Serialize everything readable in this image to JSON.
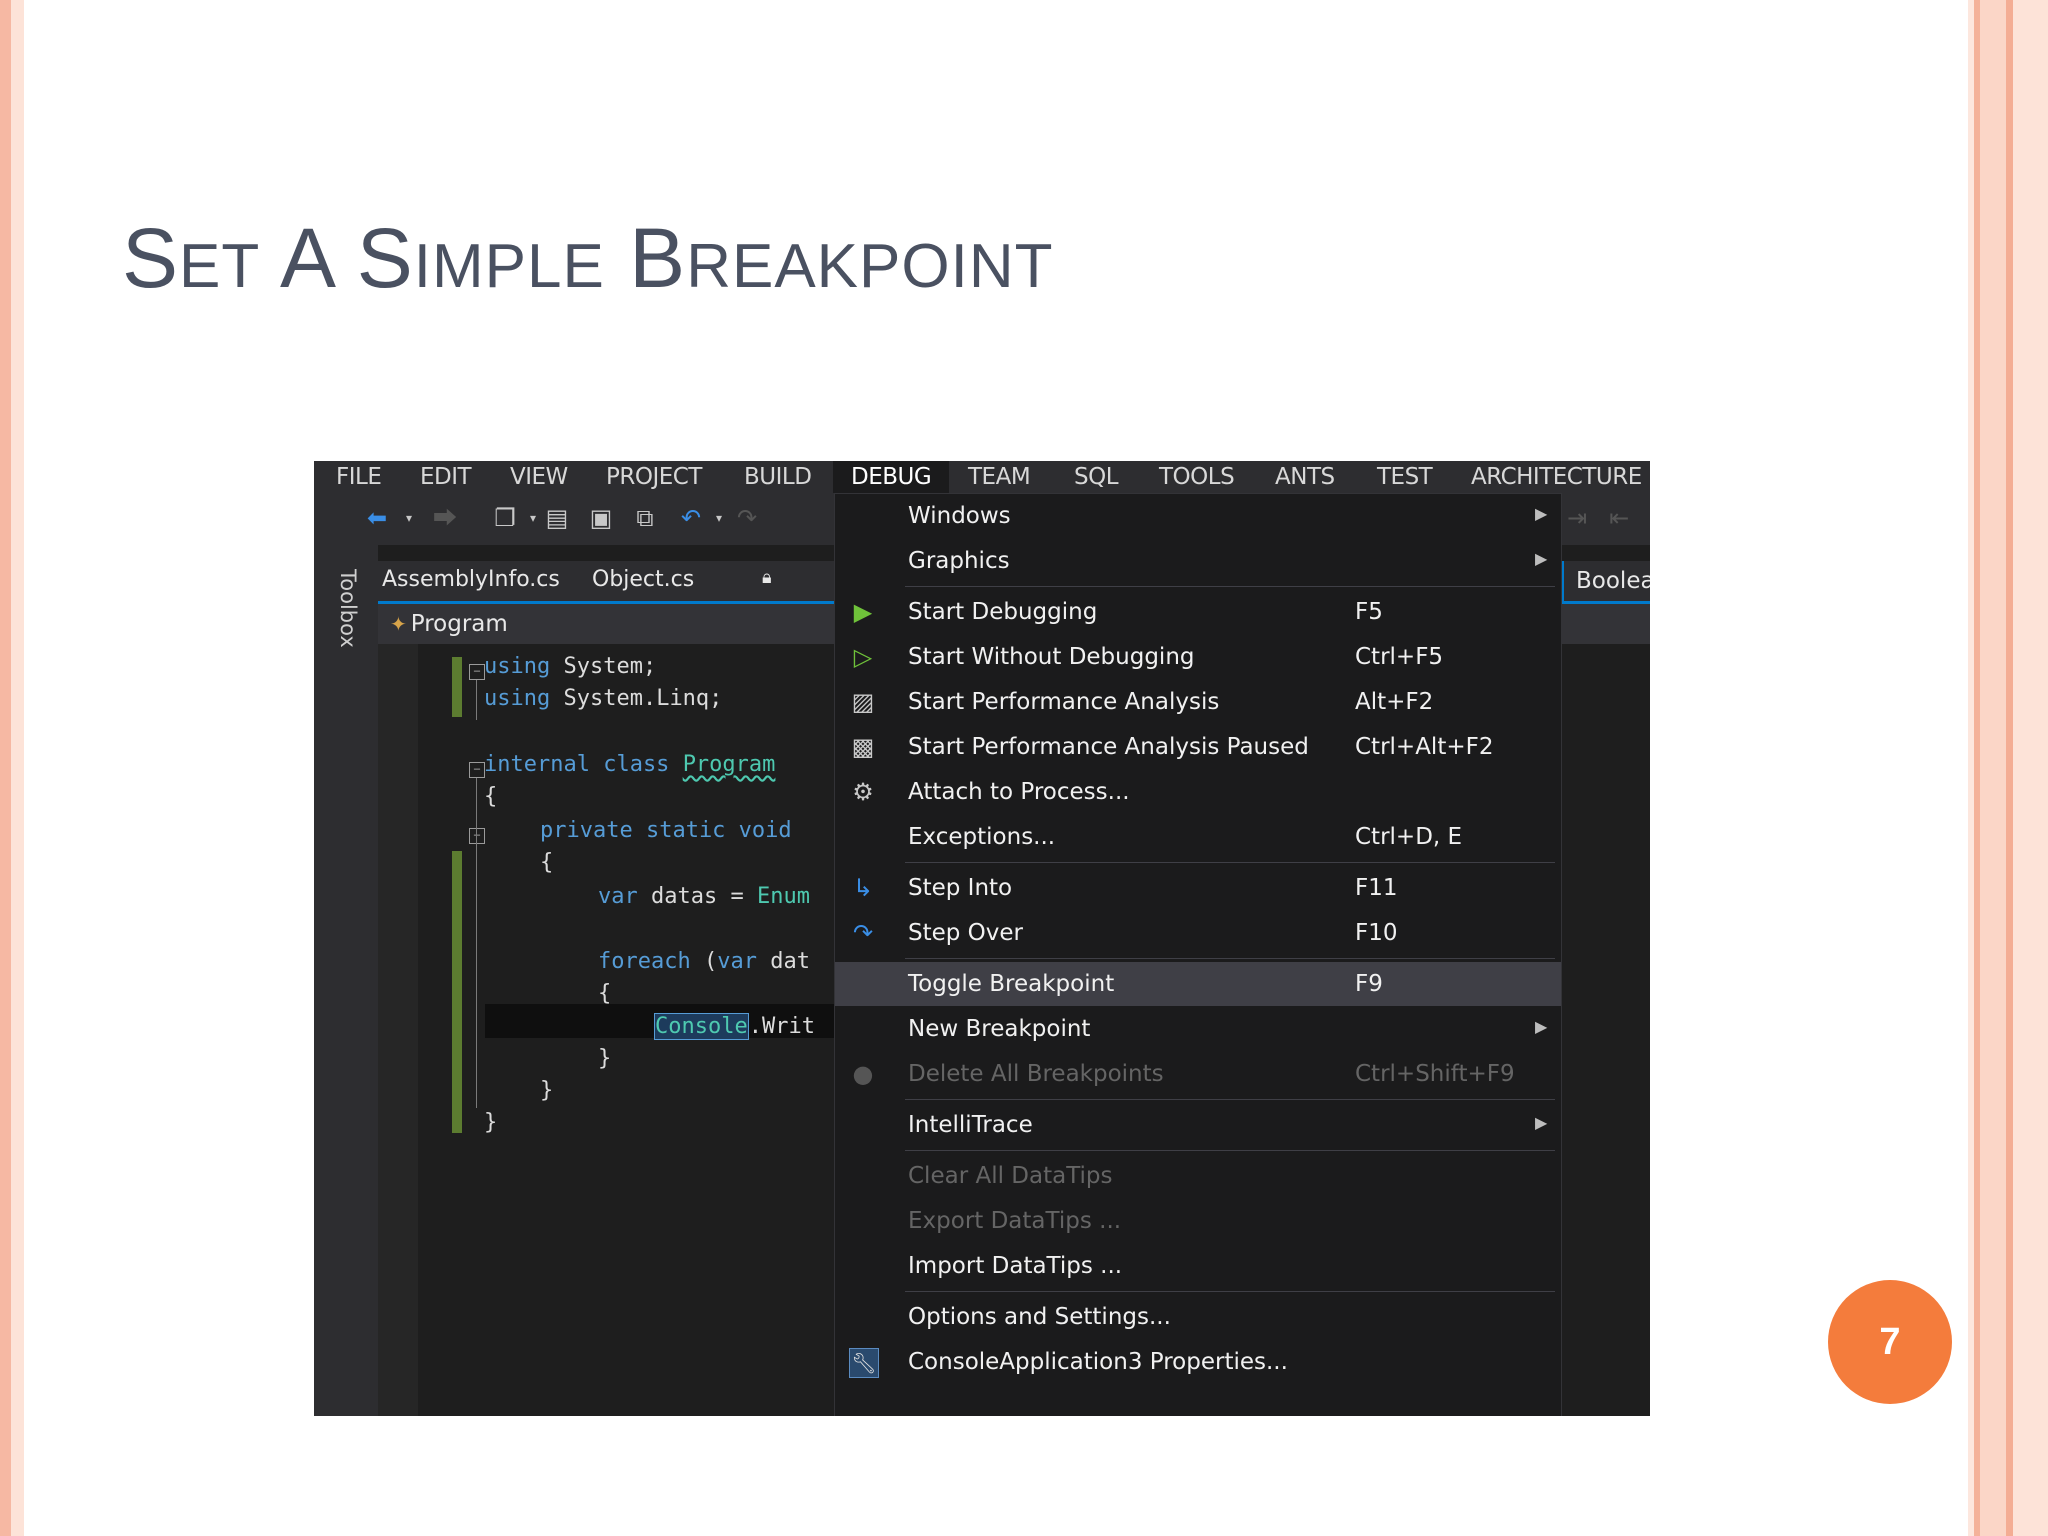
{
  "slide": {
    "title_parts": [
      {
        "cap": "S",
        "rest": "ET"
      },
      {
        "cap": "A",
        "rest": ""
      },
      {
        "cap": "S",
        "rest": "IMPLE"
      },
      {
        "cap": "B",
        "rest": "REAKPOINT"
      }
    ],
    "page_number": "7",
    "accent_color": "#f47c3c"
  },
  "ide": {
    "menu": [
      "FILE",
      "EDIT",
      "VIEW",
      "PROJECT",
      "BUILD",
      "DEBUG",
      "TEAM",
      "SQL",
      "TOOLS",
      "ANTS",
      "TEST",
      "ARCHITECTURE"
    ],
    "active_menu": "DEBUG",
    "toolbox_label": "Toolbox",
    "tabs": [
      "AssemblyInfo.cs",
      "Object.cs"
    ],
    "pin_icon": "lock-icon",
    "nav_class": "Program",
    "right_tab": "Boolea",
    "code_lines": [
      {
        "kw": "using",
        "rest": " System;"
      },
      {
        "kw": "using",
        "rest": " System.Linq;"
      },
      {
        "kw": "internal class",
        "type": "Program"
      },
      {
        "plain": "{"
      },
      {
        "kw": "private static void",
        "rest": ""
      },
      {
        "plain": "{"
      },
      {
        "kw": "var",
        "rest": " datas = ",
        "type": "Enum"
      },
      {
        "kw": "foreach",
        "rest": " (",
        "kw2": "var",
        "rest2": " dat"
      },
      {
        "plain": "{"
      },
      {
        "sel": "Console",
        "rest": ".Writ"
      },
      {
        "plain": "}"
      },
      {
        "plain": "}"
      },
      {
        "plain": "}"
      }
    ],
    "debug_menu": [
      {
        "label": "Windows",
        "shortcut": "",
        "submenu": true,
        "icon": ""
      },
      {
        "label": "Graphics",
        "shortcut": "",
        "submenu": true,
        "icon": ""
      },
      {
        "label": "Start Debugging",
        "shortcut": "F5",
        "icon": "play-icon"
      },
      {
        "label": "Start Without Debugging",
        "shortcut": "Ctrl+F5",
        "icon": "play-outline-icon"
      },
      {
        "label": "Start Performance Analysis",
        "shortcut": "Alt+F2",
        "icon": "performance-icon"
      },
      {
        "label": "Start Performance Analysis Paused",
        "shortcut": "Ctrl+Alt+F2",
        "icon": "performance-paused-icon"
      },
      {
        "label": "Attach to Process...",
        "shortcut": "",
        "icon": "gears-icon"
      },
      {
        "label": "Exceptions...",
        "shortcut": "Ctrl+D, E",
        "icon": ""
      },
      {
        "label": "Step Into",
        "shortcut": "F11",
        "icon": "step-into-icon"
      },
      {
        "label": "Step Over",
        "shortcut": "F10",
        "icon": "step-over-icon"
      },
      {
        "label": "Toggle Breakpoint",
        "shortcut": "F9",
        "highlighted": true,
        "icon": ""
      },
      {
        "label": "New Breakpoint",
        "shortcut": "",
        "submenu": true,
        "icon": ""
      },
      {
        "label": "Delete All Breakpoints",
        "shortcut": "Ctrl+Shift+F9",
        "disabled": true,
        "icon": "delete-breakpoints-icon"
      },
      {
        "label": "IntelliTrace",
        "shortcut": "",
        "submenu": true,
        "icon": ""
      },
      {
        "label": "Clear All DataTips",
        "shortcut": "",
        "disabled": true,
        "icon": ""
      },
      {
        "label": "Export DataTips ...",
        "shortcut": "",
        "disabled": true,
        "icon": ""
      },
      {
        "label": "Import DataTips ...",
        "shortcut": "",
        "icon": ""
      },
      {
        "label": "Options and Settings...",
        "shortcut": "",
        "icon": ""
      },
      {
        "label": "ConsoleApplication3 Properties...",
        "shortcut": "",
        "icon": "wrench-icon"
      }
    ]
  }
}
